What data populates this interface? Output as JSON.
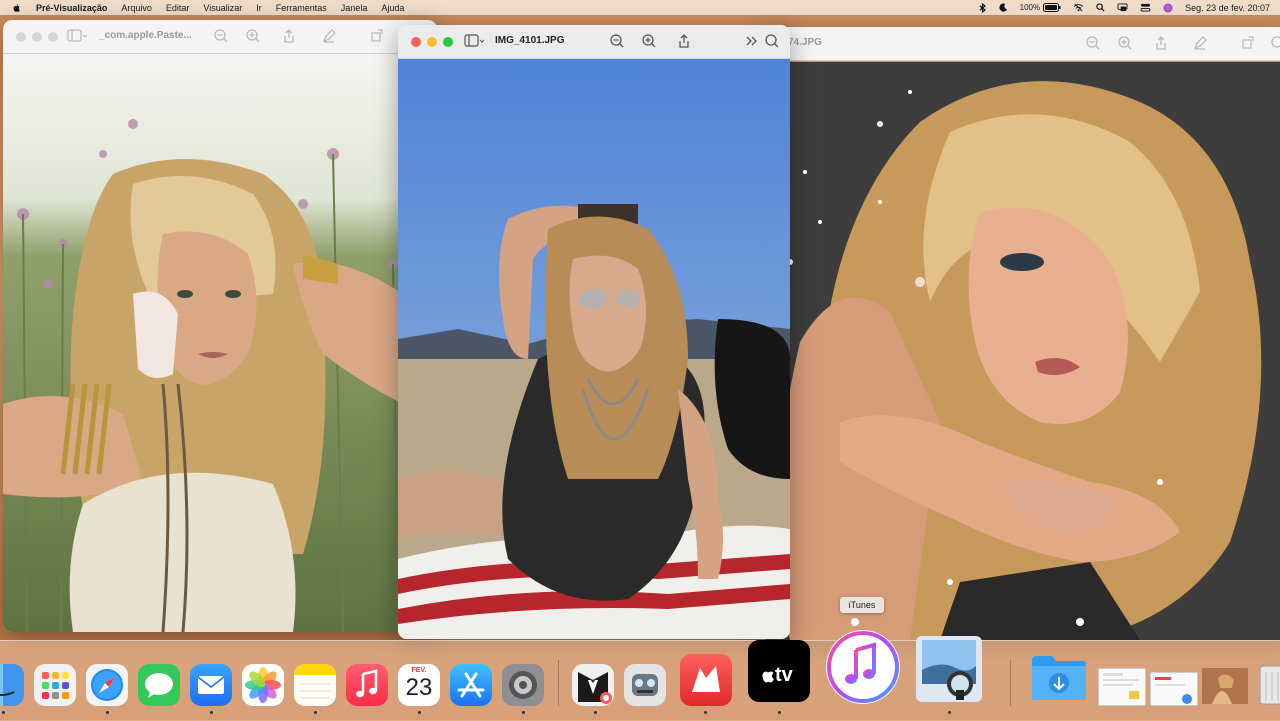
{
  "menubar": {
    "apple_icon": "apple-logo-icon",
    "items": [
      "Pré-Visualização",
      "Arquivo",
      "Editar",
      "Visualizar",
      "Ir",
      "Ferramentas",
      "Janela",
      "Ajuda"
    ],
    "battery": "100%",
    "datetime": "Seg. 23 de fev.  20:07"
  },
  "windows": {
    "left": {
      "title": "_com.apple.Paste..."
    },
    "center": {
      "title": "IMG_4101.JPG"
    },
    "right": {
      "title": "74.JPG"
    }
  },
  "tooltip": "iTunes",
  "dock": {
    "calendar_month": "FEV.",
    "calendar_day": "23",
    "apps": [
      "Finder",
      "Launchpad",
      "Safari",
      "Mensagens",
      "Mail",
      "Fotos",
      "Notas",
      "Música",
      "Calendário",
      "App Store",
      "Ajustes do Sistema",
      "Photo Booth",
      "Automator",
      "Editor",
      "Apple TV",
      "iTunes",
      "Pré-Visualização",
      "Downloads",
      "Lixo"
    ],
    "colors": {
      "music": "#fa2d48",
      "safari": "#1e88ff",
      "messages": "#34c759",
      "mail": "#1d8df5",
      "notes": "#ffd60a",
      "appstore": "#1b8cf2"
    }
  }
}
